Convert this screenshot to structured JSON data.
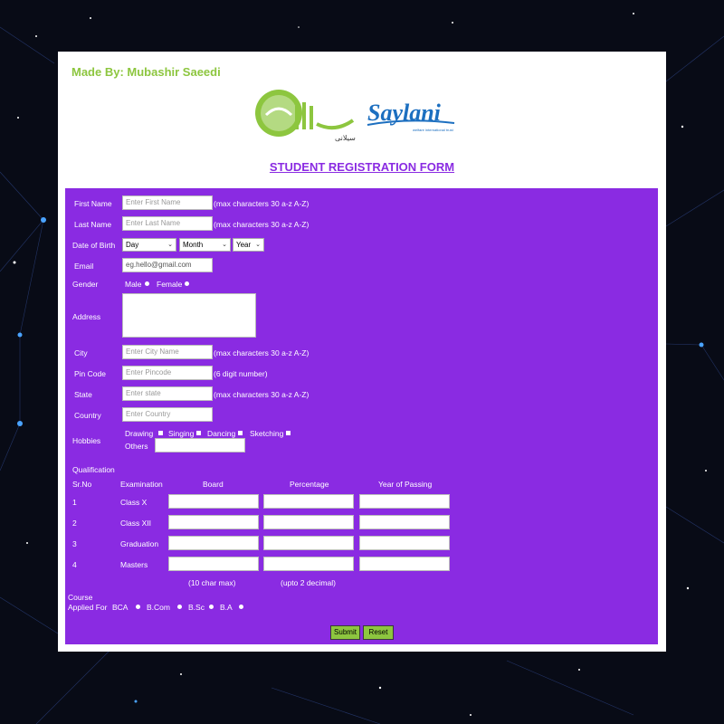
{
  "made_by": "Made By: Mubashir Saeedi",
  "logo": {
    "word": "Saylani",
    "urdu": "سیلانی",
    "tagline": "welfare international trust"
  },
  "title": "STUDENT REGISTRATION FORM",
  "fields": {
    "first_name": {
      "label": "First Name",
      "placeholder": "Enter First Name",
      "hint": "(max characters 30 a-z A-Z)"
    },
    "last_name": {
      "label": "Last Name",
      "placeholder": "Enter Last Name",
      "hint": "(max characters 30 a-z A-Z)"
    },
    "dob": {
      "label": "Date of Birth",
      "day": "Day",
      "month": "Month",
      "year": "Year"
    },
    "email": {
      "label": "Email",
      "placeholder": "eg.hello@gmail.com"
    },
    "gender": {
      "label": "Gender",
      "male": "Male",
      "female": "Female"
    },
    "address": {
      "label": "Address"
    },
    "city": {
      "label": "City",
      "placeholder": "Enter City Name",
      "hint": "(max characters 30 a-z A-Z)"
    },
    "pin": {
      "label": "Pin Code",
      "placeholder": "Enter Pincode",
      "hint": "(6 digit number)"
    },
    "state": {
      "label": "State",
      "placeholder": "Enter state",
      "hint": "(max characters 30 a-z A-Z)"
    },
    "country": {
      "label": "Country",
      "placeholder": "Enter Country"
    },
    "hobbies": {
      "label": "Hobbies",
      "drawing": "Drawing",
      "singing": "Singing",
      "dancing": "Dancing",
      "sketching": "Sketching",
      "others": "Others"
    }
  },
  "qualification": {
    "label": "Qualification",
    "headers": {
      "srno": "Sr.No",
      "exam": "Examination",
      "board": "Board",
      "percentage": "Percentage",
      "year": "Year of Passing"
    },
    "rows": [
      {
        "sr": "1",
        "exam": "Class X"
      },
      {
        "sr": "2",
        "exam": "Class XII"
      },
      {
        "sr": "3",
        "exam": "Graduation"
      },
      {
        "sr": "4",
        "exam": "Masters"
      }
    ],
    "board_note": "(10 char max)",
    "percentage_note": "(upto 2 decimal)"
  },
  "course": {
    "label_line1": "Course",
    "label_line2": "Applied For",
    "options": [
      "BCA",
      "B.Com",
      "B.Sc",
      "B.A"
    ]
  },
  "buttons": {
    "submit": "Submit",
    "reset": "Reset"
  },
  "colors": {
    "accent_purple": "#8a2be2",
    "accent_green": "#8dc63f",
    "background": "#080b16"
  }
}
